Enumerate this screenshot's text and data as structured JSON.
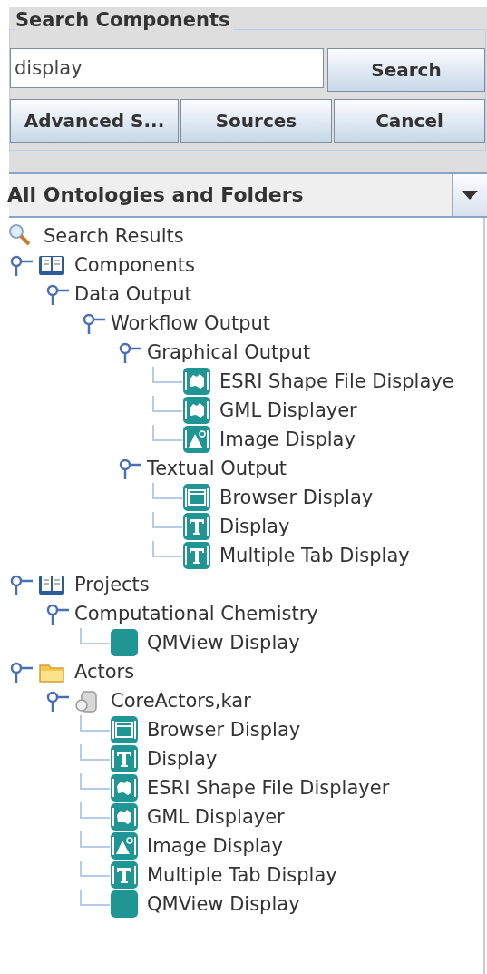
{
  "search_panel": {
    "title": "Search Components",
    "query": "display",
    "buttons": [
      "Search",
      "Advanced S...",
      "Sources",
      "Cancel"
    ]
  },
  "scope_dropdown": {
    "value": "All Ontologies and Folders"
  },
  "tree": [
    {
      "label": "Search Results",
      "kind": "search",
      "children": [
        {
          "label": "Components",
          "kind": "book",
          "expanded": true,
          "children": [
            {
              "label": "Data Output",
              "kind": "category",
              "expanded": true,
              "children": [
                {
                  "label": "Workflow Output",
                  "kind": "category",
                  "expanded": true,
                  "children": [
                    {
                      "label": "Graphical Output",
                      "kind": "category",
                      "expanded": true,
                      "children": [
                        {
                          "label": "ESRI Shape File Displaye",
                          "kind": "map"
                        },
                        {
                          "label": "GML Displayer",
                          "kind": "map"
                        },
                        {
                          "label": "Image Display",
                          "kind": "image"
                        }
                      ]
                    },
                    {
                      "label": "Textual Output",
                      "kind": "category",
                      "expanded": true,
                      "children": [
                        {
                          "label": "Browser Display",
                          "kind": "browser"
                        },
                        {
                          "label": "Display",
                          "kind": "text"
                        },
                        {
                          "label": "Multiple Tab Display",
                          "kind": "text"
                        }
                      ]
                    }
                  ]
                }
              ]
            }
          ]
        },
        {
          "label": "Projects",
          "kind": "book",
          "expanded": true,
          "children": [
            {
              "label": "Computational Chemistry",
              "kind": "category",
              "expanded": true,
              "children": [
                {
                  "label": "QMView Display",
                  "kind": "plain"
                }
              ]
            }
          ]
        },
        {
          "label": "Actors",
          "kind": "folder",
          "expanded": true,
          "children": [
            {
              "label": "CoreActors,kar",
              "kind": "kar",
              "expanded": true,
              "children": [
                {
                  "label": "Browser Display",
                  "kind": "browser"
                },
                {
                  "label": "Display",
                  "kind": "text"
                },
                {
                  "label": "ESRI Shape File Displayer",
                  "kind": "map"
                },
                {
                  "label": "GML Displayer",
                  "kind": "map"
                },
                {
                  "label": "Image Display",
                  "kind": "image"
                },
                {
                  "label": "Multiple Tab Display",
                  "kind": "text"
                },
                {
                  "label": "QMView Display",
                  "kind": "plain"
                }
              ]
            }
          ]
        }
      ]
    }
  ]
}
